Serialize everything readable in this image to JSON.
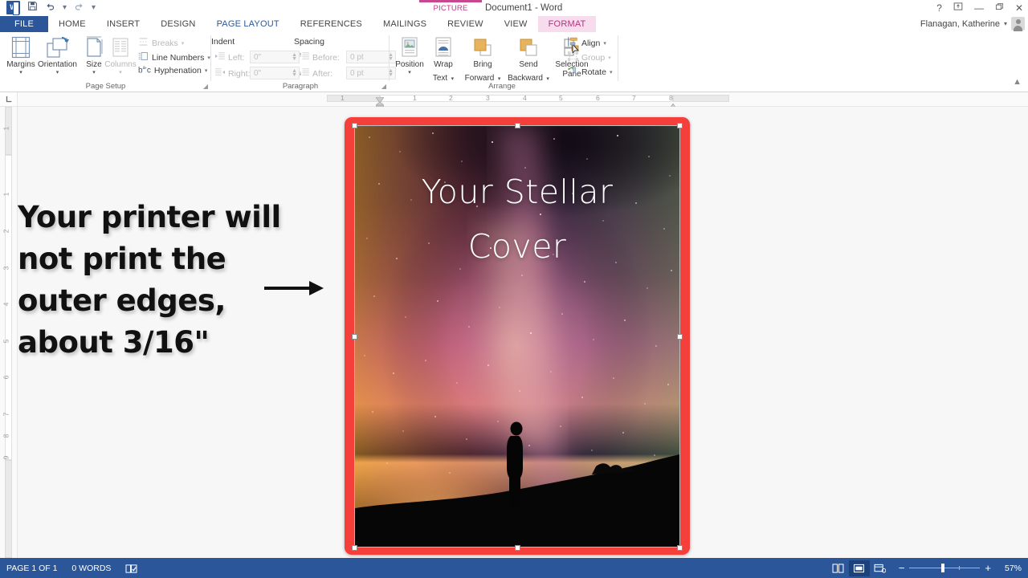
{
  "app": {
    "document_title": "Document1 - Word",
    "contextual_tab_group": "PICTURE TOOLS",
    "user_name": "Flanagan, Katherine"
  },
  "quick_access": [
    {
      "name": "save-icon",
      "glyph": "ὋE"
    },
    {
      "name": "undo-icon",
      "glyph": "↶"
    },
    {
      "name": "redo-icon",
      "glyph": "↻"
    },
    {
      "name": "customize-qat-icon",
      "glyph": "⌄"
    }
  ],
  "window_buttons": {
    "help": "?",
    "ribbon_display": "⌶",
    "minimize": "—",
    "restore": "❐",
    "close": "✕"
  },
  "tabs": [
    {
      "label": "FILE",
      "type": "file"
    },
    {
      "label": "HOME",
      "type": "normal"
    },
    {
      "label": "INSERT",
      "type": "normal"
    },
    {
      "label": "DESIGN",
      "type": "normal"
    },
    {
      "label": "PAGE LAYOUT",
      "type": "active"
    },
    {
      "label": "REFERENCES",
      "type": "normal"
    },
    {
      "label": "MAILINGS",
      "type": "normal"
    },
    {
      "label": "REVIEW",
      "type": "normal"
    },
    {
      "label": "VIEW",
      "type": "normal"
    },
    {
      "label": "FORMAT",
      "type": "contextual"
    }
  ],
  "ribbon": {
    "groups": [
      {
        "name": "Page Setup"
      },
      {
        "name": "Paragraph"
      },
      {
        "name": "Arrange"
      }
    ],
    "page_setup": {
      "big_buttons": [
        {
          "label": "Margins",
          "enabled": true,
          "caret": "▾"
        },
        {
          "label": "Orientation",
          "enabled": true,
          "caret": "▾"
        },
        {
          "label": "Size",
          "enabled": true,
          "caret": "▾"
        },
        {
          "label": "Columns",
          "enabled": false,
          "caret": "▾"
        }
      ],
      "small_items": [
        {
          "label": "Breaks",
          "enabled": false,
          "caret": "▾"
        },
        {
          "label": "Line Numbers",
          "enabled": true,
          "caret": "▾"
        },
        {
          "label": "Hyphenation",
          "enabled": true,
          "caret": "▾"
        }
      ]
    },
    "paragraph": {
      "indent_heading": "Indent",
      "spacing_heading": "Spacing",
      "fields": [
        {
          "label": "Left:",
          "value": "0\""
        },
        {
          "label": "Right:",
          "value": "0\""
        },
        {
          "label": "Before:",
          "value": "0 pt"
        },
        {
          "label": "After:",
          "value": "0 pt"
        }
      ]
    },
    "arrange": {
      "big_buttons": [
        {
          "label_1": "Position",
          "label_2": "",
          "caret": "▾"
        },
        {
          "label_1": "Wrap",
          "label_2": "Text",
          "caret": "▾"
        },
        {
          "label_1": "Bring",
          "label_2": "Forward",
          "caret": "▾"
        },
        {
          "label_1": "Send",
          "label_2": "Backward",
          "caret": "▾"
        },
        {
          "label_1": "Selection",
          "label_2": "Pane",
          "caret": ""
        }
      ],
      "small_items": [
        {
          "label": "Align",
          "enabled": true,
          "caret": "▾"
        },
        {
          "label": "Group",
          "enabled": false,
          "caret": "▾"
        },
        {
          "label": "Rotate",
          "enabled": true,
          "caret": "▾"
        }
      ]
    },
    "collapse_icon": "▲"
  },
  "rulers": {
    "corner_icon": "L",
    "horizontal_numbers": [
      "1",
      "1",
      "2",
      "3",
      "4",
      "5",
      "6",
      "7",
      "8"
    ],
    "vertical_numbers": [
      "1",
      "1",
      "2",
      "3",
      "4",
      "5",
      "6",
      "7",
      "8",
      "9"
    ]
  },
  "canvas": {
    "annotation_lines": [
      "Your printer will",
      "not print the",
      "outer edges,",
      "about 3/16\""
    ],
    "arrow_icon": "right-arrow",
    "page_border_color": "#f43f3b",
    "cover_title_lines": [
      "Your Stellar",
      "Cover"
    ],
    "image_description": "night-sky-milky-way-silhouette"
  },
  "status_bar": {
    "page_label": "PAGE 1 OF 1",
    "word_count": "0 WORDS",
    "proofing_icon": "proofing-errors-icon",
    "view_buttons": [
      {
        "name": "read-mode-view",
        "active": false
      },
      {
        "name": "print-layout-view",
        "active": true
      },
      {
        "name": "web-layout-view",
        "active": false
      }
    ],
    "zoom_out": "−",
    "zoom_in": "+",
    "zoom_value": "57%"
  }
}
